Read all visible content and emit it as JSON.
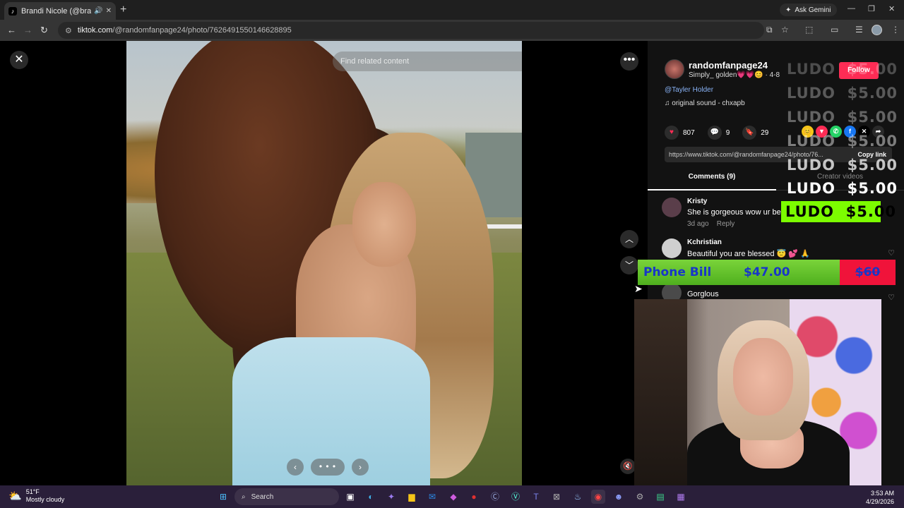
{
  "browser": {
    "tab_title": "Brandi Nicole (@brandinic",
    "tab_favicon": "tiktok-icon",
    "gemini_label": "Ask Gemini",
    "url_host": "tiktok.com",
    "url_path": "/@randomfanpage24/photo/7626491550146628895"
  },
  "viewer": {
    "search_placeholder": "Find related content"
  },
  "post": {
    "author_handle": "randomfanpage24",
    "author_subtitle": "Simply_ golden💗💗😊 · 4-8",
    "follow_label": "Follow",
    "mention": "@Tayler Holder",
    "sound": "original sound - chxapb",
    "likes": "807",
    "comments_count": "9",
    "saves": "29",
    "link_url": "https://www.tiktok.com/@randomfanpage24/photo/76...",
    "copy_link_label": "Copy link",
    "tab_comments": "Comments (9)",
    "tab_creator_videos": "Creator videos"
  },
  "comments": [
    {
      "name": "Kristy",
      "text": "She is gorgeous wow ur be",
      "time": "3d ago",
      "reply": "Reply"
    },
    {
      "name": "Kchristian",
      "text": "Beautiful you are blessed 😇 💕 🙏",
      "time": "",
      "reply": ""
    },
    {
      "name": "",
      "text": "Gorglous",
      "time": "",
      "reply": ""
    }
  ],
  "overlay": {
    "ludo_rows": [
      {
        "label": "LUDO",
        "amount": "$5.00"
      },
      {
        "label": "LUDO",
        "amount": "$5.00"
      },
      {
        "label": "LUDO",
        "amount": "$5.00"
      },
      {
        "label": "LUDO",
        "amount": "$5.00"
      },
      {
        "label": "LUDO",
        "amount": "$5.00"
      },
      {
        "label": "LUDO",
        "amount": "$5.00"
      }
    ],
    "ludo_final": {
      "label": "LUDO",
      "amount": "$5.00"
    },
    "bill_label": "Phone Bill",
    "bill_amount": "$47.00",
    "bill_target": "$60"
  },
  "taskbar": {
    "temp": "51°F",
    "weather": "Mostly cloudy",
    "search_label": "Search",
    "time": "3:53 AM",
    "date": "4/29/2026"
  },
  "colors": {
    "follow": "#fe2c55",
    "ludo_final_bg": "#7cfc00",
    "bill_green": "#5bc428",
    "bill_red": "#f0133a",
    "bill_text": "#1836c8"
  }
}
